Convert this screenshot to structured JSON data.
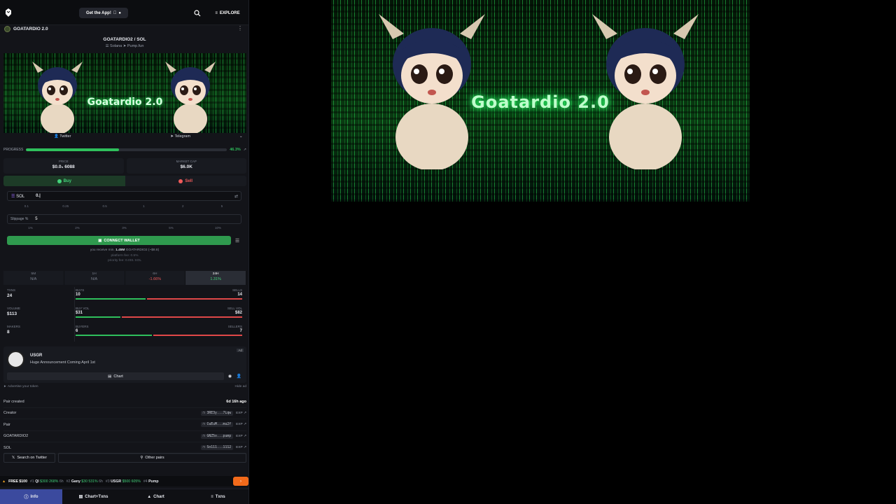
{
  "topbar": {
    "get_app": "Get the App!",
    "explore": "EXPLORE"
  },
  "token": {
    "name": "GOATARDIO 2.0",
    "pair_title": "GOATARDIO2 / SOL",
    "chain": "Solana",
    "dex": "Pump.fun"
  },
  "banner": {
    "title": "Goatardio 2.0"
  },
  "socials": {
    "twitter": "Twitter",
    "telegram": "Telegram"
  },
  "progress": {
    "label": "PROGRESS",
    "value_text": "46.3%",
    "value": 0.463
  },
  "price": {
    "label": "PRICE",
    "value": "$0.0₅ 6088"
  },
  "market_cap": {
    "label": "MARKET CAP",
    "value": "$6.0K"
  },
  "trade": {
    "buy": "Buy",
    "sell": "Sell",
    "currency": "SOL",
    "amount": "0.|",
    "presets": [
      "0.1",
      "0.25",
      "0.5",
      "1",
      "2",
      "5"
    ],
    "slippage_label": "Slippage %",
    "slippage_value": "5",
    "slippage_presets": [
      "1%",
      "2%",
      "3%",
      "5%",
      "10%"
    ],
    "connect": "CONNECT WALLET",
    "receive_prefix": "you receive min.",
    "receive_amount": "1.45M",
    "receive_suffix": "GOATARDIO2 (~$8.8)",
    "platform_fee": "platform fee: 0.5%",
    "priority_fee": "priority fee: 0.001 SOL"
  },
  "timeframes": [
    {
      "k": "5M",
      "v": "N/A",
      "cls": ""
    },
    {
      "k": "1H",
      "v": "N/A",
      "cls": ""
    },
    {
      "k": "6H",
      "v": "-1.66%",
      "cls": "neg"
    },
    {
      "k": "24H",
      "v": "1.31%",
      "cls": "pos"
    }
  ],
  "metrics": {
    "txns": {
      "label": "TXNS",
      "value": "24",
      "left_label": "BUYS",
      "right_label": "SELLS",
      "left": "10",
      "right": "14",
      "ratio": 0.42
    },
    "volume": {
      "label": "VOLUME",
      "value": "$113",
      "left_label": "BUY VOL",
      "right_label": "SELL VOL",
      "left": "$31",
      "right": "$82",
      "ratio": 0.27
    },
    "makers": {
      "label": "MAKERS",
      "value": "8",
      "left_label": "BUYERS",
      "right_label": "SELLERS",
      "left": "6",
      "right": "7",
      "ratio": 0.46
    }
  },
  "ad": {
    "tag": "Ad",
    "name": "USGR",
    "desc": "Huge Announcement Coming April 1st",
    "chart": "Chart"
  },
  "advertise": {
    "left": "Advertise your token",
    "right": "Hide ad"
  },
  "info": {
    "pair_created_label": "Pair created",
    "pair_created_value": "6d 16h ago",
    "rows": [
      {
        "label": "Creator",
        "addr": "3RE3y...7Lqw",
        "exp": "EXP"
      },
      {
        "label": "Pair",
        "addr": "CwEuM...mu2f",
        "exp": "EXP"
      },
      {
        "label": "GOATARDIO2",
        "addr": "GNZ5o...pump",
        "exp": "EXP"
      },
      {
        "label": "SOL",
        "addr": "So111...1112",
        "exp": "EXP"
      }
    ]
  },
  "bottom_buttons": {
    "twitter": "Search on Twitter",
    "other": "Other pairs"
  },
  "ticker": {
    "free": "FREE $100",
    "items": [
      {
        "rank": "#1",
        "name": "Ql",
        "vals": "$300 268%",
        "age": "6h"
      },
      {
        "rank": "#2",
        "name": "Gany",
        "vals": "$30 531%",
        "age": "6h"
      },
      {
        "rank": "#3",
        "name": "USGR",
        "vals": "$500 605%",
        "age": ""
      },
      {
        "rank": "#4",
        "name": "Pump",
        "vals": "",
        "age": ""
      }
    ]
  },
  "nav": {
    "info": "Info",
    "chart_txns": "Chart+Txns",
    "chart": "Chart",
    "txns": "Txns"
  },
  "video": {
    "title": "Goatardio 2.0"
  },
  "colors": {
    "green": "#2fbf5c",
    "red": "#e04848",
    "nav_active": "#3b4a9e",
    "ticker_button": "#f26a1b"
  }
}
